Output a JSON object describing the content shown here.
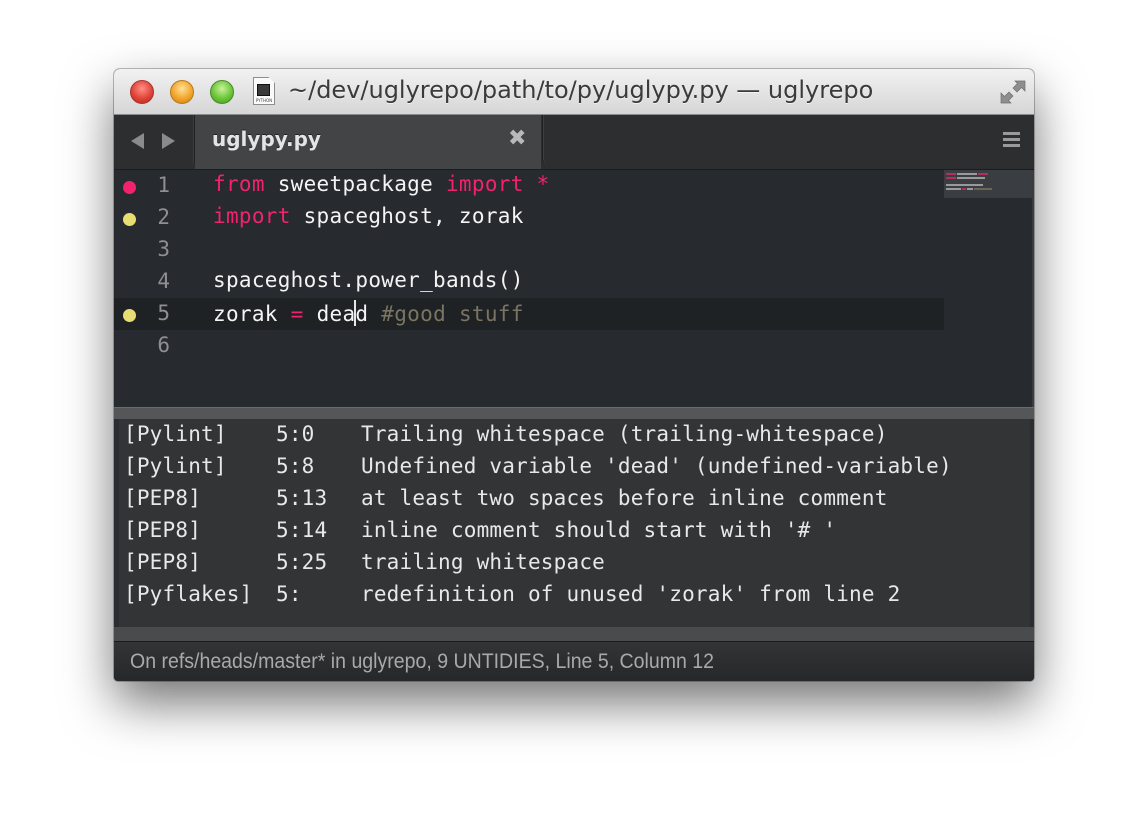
{
  "window": {
    "title": "~/dev/uglyrepo/path/to/py/uglypy.py — uglyrepo",
    "proxy_icon_label": "PYTHON",
    "icons": {
      "close": "close-traffic-light",
      "minimize": "minimize-traffic-light",
      "zoom": "zoom-traffic-light",
      "fullscreen": "fullscreen-arrows-icon"
    }
  },
  "tabbar": {
    "back_icon": "chevron-left-icon",
    "forward_icon": "chevron-right-icon",
    "tabs": [
      {
        "label": "uglypy.py",
        "active": true,
        "close_glyph": "✖"
      }
    ],
    "menu_icon": "hamburger-menu-icon"
  },
  "editor": {
    "colors": {
      "keyword": "#f2236e",
      "comment": "#7a7462",
      "text": "#f4f4f4",
      "background": "#272a2e",
      "error_marker": "#f2236e",
      "warning_marker": "#e8dd72"
    },
    "current_line": 5,
    "lines": [
      {
        "number": "1",
        "marker": "error",
        "tokens": [
          {
            "t": "from",
            "c": "kw"
          },
          {
            "t": " sweetpackage ",
            "c": ""
          },
          {
            "t": "import",
            "c": "kw"
          },
          {
            "t": " ",
            "c": ""
          },
          {
            "t": "*",
            "c": "op"
          }
        ]
      },
      {
        "number": "2",
        "marker": "warning",
        "tokens": [
          {
            "t": "import",
            "c": "kw"
          },
          {
            "t": " spaceghost, zorak",
            "c": ""
          }
        ]
      },
      {
        "number": "3",
        "marker": "",
        "tokens": []
      },
      {
        "number": "4",
        "marker": "",
        "tokens": [
          {
            "t": "spaceghost.power_bands()",
            "c": ""
          }
        ]
      },
      {
        "number": "5",
        "marker": "warning",
        "tokens": [
          {
            "t": "zorak ",
            "c": ""
          },
          {
            "t": "=",
            "c": "op"
          },
          {
            "t": " dea",
            "c": ""
          },
          {
            "t": "|",
            "c": "caret"
          },
          {
            "t": "d ",
            "c": ""
          },
          {
            "t": "#good stuff",
            "c": "cm"
          }
        ]
      },
      {
        "number": "6",
        "marker": "",
        "tokens": []
      }
    ]
  },
  "output": {
    "rows": [
      {
        "source": "[Pylint]",
        "location": "5:0",
        "message": "Trailing whitespace (trailing-whitespace)"
      },
      {
        "source": "[Pylint]",
        "location": "5:8",
        "message": "Undefined variable 'dead' (undefined-variable)"
      },
      {
        "source": "[PEP8]",
        "location": "5:13",
        "message": "at least two spaces before inline comment"
      },
      {
        "source": "[PEP8]",
        "location": "5:14",
        "message": "inline comment should start with '# '"
      },
      {
        "source": "[PEP8]",
        "location": "5:25",
        "message": "trailing whitespace"
      },
      {
        "source": "[Pyflakes]",
        "location": "5:",
        "message": "redefinition of unused 'zorak' from line 2"
      }
    ]
  },
  "statusbar": {
    "text": "On refs/heads/master* in uglyrepo, 9 UNTIDIES, Line 5, Column 12"
  }
}
